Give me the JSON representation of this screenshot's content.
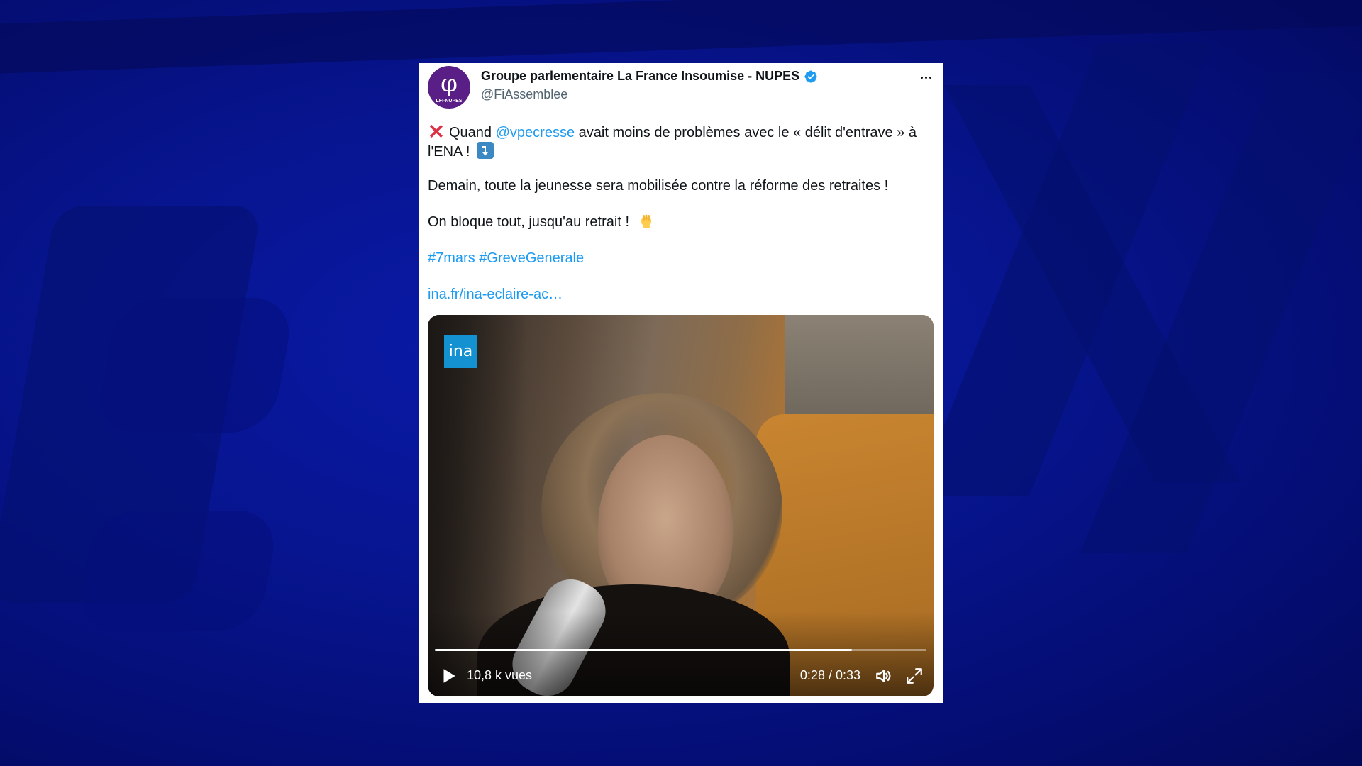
{
  "account": {
    "name": "Groupe parlementaire La France Insoumise - NUPES",
    "handle": "@FiAssemblee",
    "avatar_text": "LFI-NUPES"
  },
  "tweet": {
    "line1_before": "Quand",
    "mention": "@vpecresse",
    "line1_after": "avait moins de problèmes avec le « délit d'entrave » à l'ENA !",
    "paragraph2": "Demain, toute la jeunesse sera mobilisée contre la réforme des retraites !",
    "paragraph3": "On bloque tout, jusqu'au retrait !",
    "hashtag1": "#7mars",
    "hashtag2": "#GreveGenerale",
    "link": "ina.fr/ina-eclaire-ac…"
  },
  "video": {
    "logo": "ina",
    "views": "10,8 k vues",
    "time": "0:28 / 0:33",
    "progress_fraction": 0.848
  },
  "icons": {
    "verified": "verified-badge-icon",
    "more": "more-options-icon",
    "play": "play-icon",
    "volume": "volume-icon",
    "fullscreen": "fullscreen-icon"
  },
  "colors": {
    "link": "#1d9bf0",
    "verified": "#1d9bf0",
    "avatar": "#5a1f86",
    "ina": "#1391d0"
  }
}
